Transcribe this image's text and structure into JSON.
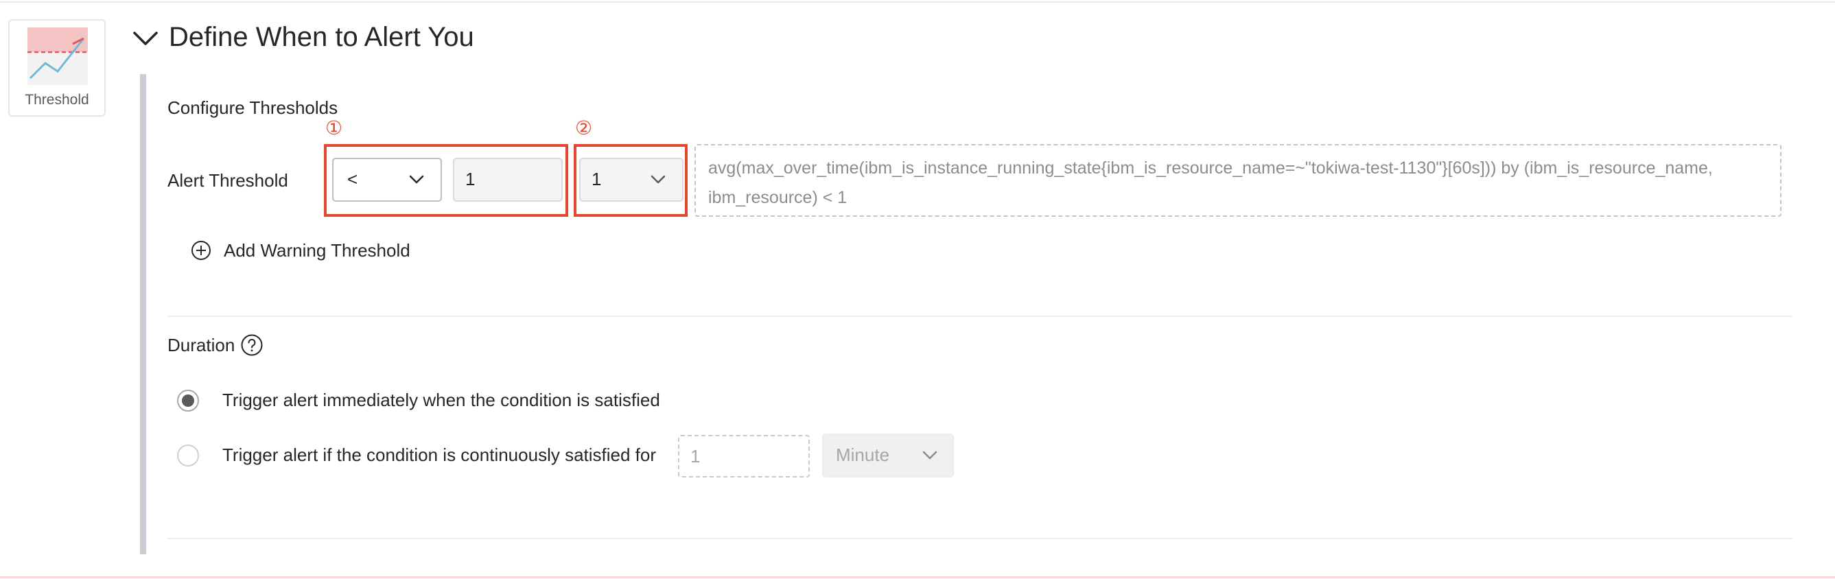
{
  "rule_type_card": {
    "label": "Threshold",
    "icon": "threshold-chart-icon"
  },
  "section": {
    "title": "Define When to Alert You",
    "collapse_icon": "chevron-down-icon"
  },
  "thresholds": {
    "heading": "Configure Thresholds",
    "alert_label": "Alert Threshold",
    "operator": "<",
    "value": "1",
    "level": "1",
    "query_preview": "avg(max_over_time(ibm_is_instance_running_state{ibm_is_resource_name=~\"tokiwa-test-1130\"}[60s])) by (ibm_is_resource_name, ibm_resource) < 1",
    "add_warning_label": "Add Warning Threshold",
    "add_icon": "plus-circle-icon"
  },
  "annotations": {
    "marker_1": "①",
    "marker_2": "②",
    "highlight_color": "#e4472f"
  },
  "duration": {
    "heading": "Duration",
    "help_icon": "question-circle-icon",
    "option_immediate": "Trigger alert immediately when the condition is satisfied",
    "option_continuous": "Trigger alert if the condition is continuously satisfied for",
    "selected_option": "immediate",
    "continuous_value": "1",
    "unit": "Minute"
  }
}
